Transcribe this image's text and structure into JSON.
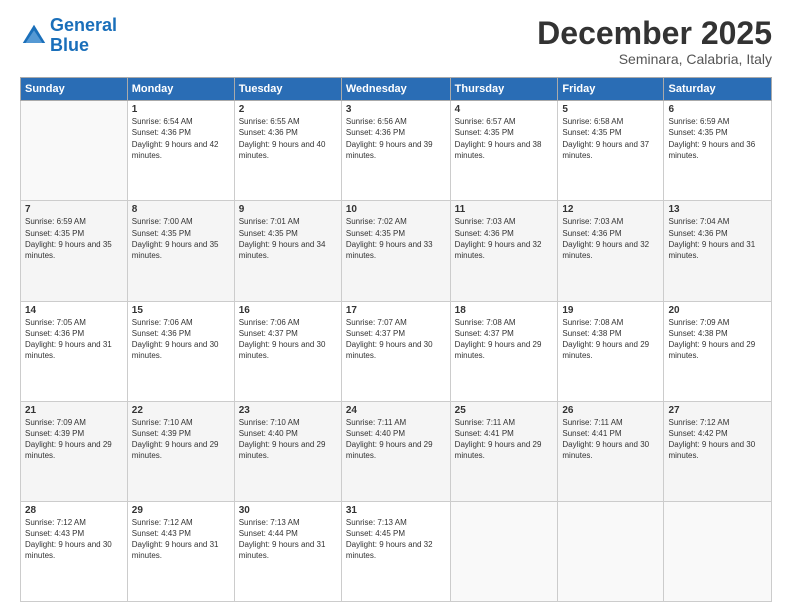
{
  "logo": {
    "line1": "General",
    "line2": "Blue"
  },
  "title": "December 2025",
  "subtitle": "Seminara, Calabria, Italy",
  "days_header": [
    "Sunday",
    "Monday",
    "Tuesday",
    "Wednesday",
    "Thursday",
    "Friday",
    "Saturday"
  ],
  "weeks": [
    [
      {
        "num": "",
        "sunrise": "",
        "sunset": "",
        "daylight": ""
      },
      {
        "num": "1",
        "sunrise": "Sunrise: 6:54 AM",
        "sunset": "Sunset: 4:36 PM",
        "daylight": "Daylight: 9 hours and 42 minutes."
      },
      {
        "num": "2",
        "sunrise": "Sunrise: 6:55 AM",
        "sunset": "Sunset: 4:36 PM",
        "daylight": "Daylight: 9 hours and 40 minutes."
      },
      {
        "num": "3",
        "sunrise": "Sunrise: 6:56 AM",
        "sunset": "Sunset: 4:36 PM",
        "daylight": "Daylight: 9 hours and 39 minutes."
      },
      {
        "num": "4",
        "sunrise": "Sunrise: 6:57 AM",
        "sunset": "Sunset: 4:35 PM",
        "daylight": "Daylight: 9 hours and 38 minutes."
      },
      {
        "num": "5",
        "sunrise": "Sunrise: 6:58 AM",
        "sunset": "Sunset: 4:35 PM",
        "daylight": "Daylight: 9 hours and 37 minutes."
      },
      {
        "num": "6",
        "sunrise": "Sunrise: 6:59 AM",
        "sunset": "Sunset: 4:35 PM",
        "daylight": "Daylight: 9 hours and 36 minutes."
      }
    ],
    [
      {
        "num": "7",
        "sunrise": "Sunrise: 6:59 AM",
        "sunset": "Sunset: 4:35 PM",
        "daylight": "Daylight: 9 hours and 35 minutes."
      },
      {
        "num": "8",
        "sunrise": "Sunrise: 7:00 AM",
        "sunset": "Sunset: 4:35 PM",
        "daylight": "Daylight: 9 hours and 35 minutes."
      },
      {
        "num": "9",
        "sunrise": "Sunrise: 7:01 AM",
        "sunset": "Sunset: 4:35 PM",
        "daylight": "Daylight: 9 hours and 34 minutes."
      },
      {
        "num": "10",
        "sunrise": "Sunrise: 7:02 AM",
        "sunset": "Sunset: 4:35 PM",
        "daylight": "Daylight: 9 hours and 33 minutes."
      },
      {
        "num": "11",
        "sunrise": "Sunrise: 7:03 AM",
        "sunset": "Sunset: 4:36 PM",
        "daylight": "Daylight: 9 hours and 32 minutes."
      },
      {
        "num": "12",
        "sunrise": "Sunrise: 7:03 AM",
        "sunset": "Sunset: 4:36 PM",
        "daylight": "Daylight: 9 hours and 32 minutes."
      },
      {
        "num": "13",
        "sunrise": "Sunrise: 7:04 AM",
        "sunset": "Sunset: 4:36 PM",
        "daylight": "Daylight: 9 hours and 31 minutes."
      }
    ],
    [
      {
        "num": "14",
        "sunrise": "Sunrise: 7:05 AM",
        "sunset": "Sunset: 4:36 PM",
        "daylight": "Daylight: 9 hours and 31 minutes."
      },
      {
        "num": "15",
        "sunrise": "Sunrise: 7:06 AM",
        "sunset": "Sunset: 4:36 PM",
        "daylight": "Daylight: 9 hours and 30 minutes."
      },
      {
        "num": "16",
        "sunrise": "Sunrise: 7:06 AM",
        "sunset": "Sunset: 4:37 PM",
        "daylight": "Daylight: 9 hours and 30 minutes."
      },
      {
        "num": "17",
        "sunrise": "Sunrise: 7:07 AM",
        "sunset": "Sunset: 4:37 PM",
        "daylight": "Daylight: 9 hours and 30 minutes."
      },
      {
        "num": "18",
        "sunrise": "Sunrise: 7:08 AM",
        "sunset": "Sunset: 4:37 PM",
        "daylight": "Daylight: 9 hours and 29 minutes."
      },
      {
        "num": "19",
        "sunrise": "Sunrise: 7:08 AM",
        "sunset": "Sunset: 4:38 PM",
        "daylight": "Daylight: 9 hours and 29 minutes."
      },
      {
        "num": "20",
        "sunrise": "Sunrise: 7:09 AM",
        "sunset": "Sunset: 4:38 PM",
        "daylight": "Daylight: 9 hours and 29 minutes."
      }
    ],
    [
      {
        "num": "21",
        "sunrise": "Sunrise: 7:09 AM",
        "sunset": "Sunset: 4:39 PM",
        "daylight": "Daylight: 9 hours and 29 minutes."
      },
      {
        "num": "22",
        "sunrise": "Sunrise: 7:10 AM",
        "sunset": "Sunset: 4:39 PM",
        "daylight": "Daylight: 9 hours and 29 minutes."
      },
      {
        "num": "23",
        "sunrise": "Sunrise: 7:10 AM",
        "sunset": "Sunset: 4:40 PM",
        "daylight": "Daylight: 9 hours and 29 minutes."
      },
      {
        "num": "24",
        "sunrise": "Sunrise: 7:11 AM",
        "sunset": "Sunset: 4:40 PM",
        "daylight": "Daylight: 9 hours and 29 minutes."
      },
      {
        "num": "25",
        "sunrise": "Sunrise: 7:11 AM",
        "sunset": "Sunset: 4:41 PM",
        "daylight": "Daylight: 9 hours and 29 minutes."
      },
      {
        "num": "26",
        "sunrise": "Sunrise: 7:11 AM",
        "sunset": "Sunset: 4:41 PM",
        "daylight": "Daylight: 9 hours and 30 minutes."
      },
      {
        "num": "27",
        "sunrise": "Sunrise: 7:12 AM",
        "sunset": "Sunset: 4:42 PM",
        "daylight": "Daylight: 9 hours and 30 minutes."
      }
    ],
    [
      {
        "num": "28",
        "sunrise": "Sunrise: 7:12 AM",
        "sunset": "Sunset: 4:43 PM",
        "daylight": "Daylight: 9 hours and 30 minutes."
      },
      {
        "num": "29",
        "sunrise": "Sunrise: 7:12 AM",
        "sunset": "Sunset: 4:43 PM",
        "daylight": "Daylight: 9 hours and 31 minutes."
      },
      {
        "num": "30",
        "sunrise": "Sunrise: 7:13 AM",
        "sunset": "Sunset: 4:44 PM",
        "daylight": "Daylight: 9 hours and 31 minutes."
      },
      {
        "num": "31",
        "sunrise": "Sunrise: 7:13 AM",
        "sunset": "Sunset: 4:45 PM",
        "daylight": "Daylight: 9 hours and 32 minutes."
      },
      {
        "num": "",
        "sunrise": "",
        "sunset": "",
        "daylight": ""
      },
      {
        "num": "",
        "sunrise": "",
        "sunset": "",
        "daylight": ""
      },
      {
        "num": "",
        "sunrise": "",
        "sunset": "",
        "daylight": ""
      }
    ]
  ]
}
